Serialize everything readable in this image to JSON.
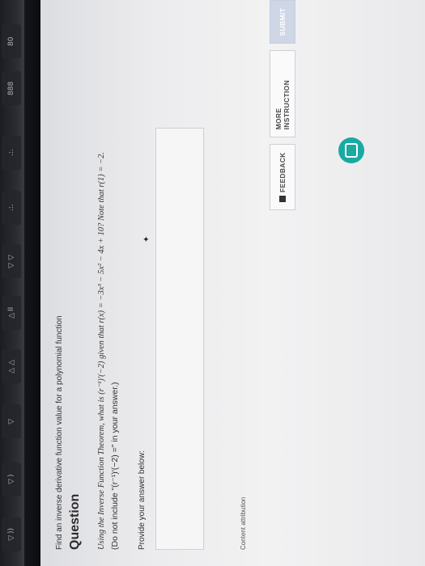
{
  "keyboard": {
    "keys": [
      "80",
      "888",
      ".:.",
      ".:.",
      "◁◁",
      "▷II",
      "▷▷",
      "◁",
      "◁)",
      "◁))"
    ]
  },
  "page": {
    "breadcrumb": "Find an inverse derivative function value for a polynomial function",
    "heading": "Question",
    "question_line1": "Using the Inverse Function Theorem, what is (r⁻¹)′(−2) given that r(x) = −3x³ − 5x² − 4x + 10? Note that r(1) = −2.",
    "question_line2": "(Do not include \"(r⁻¹)′(−2) =\" in your answer.)",
    "provide_label": "Provide your answer below:",
    "answer_value": "",
    "attribution": "Content attribution",
    "buttons": {
      "feedback": "FEEDBACK",
      "more_instruction": "MORE INSTRUCTION",
      "submit": "SUBMIT"
    }
  },
  "colors": {
    "accent": "#1aa9a3",
    "submit_disabled": "#cfd7e6"
  }
}
